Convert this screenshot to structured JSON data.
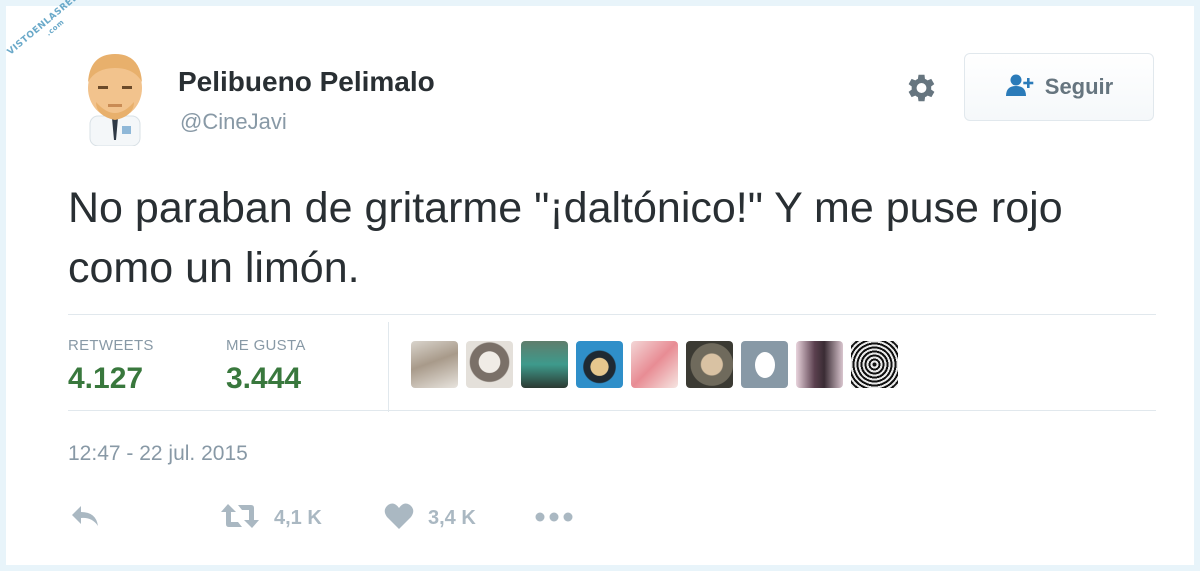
{
  "watermark": {
    "line1": "VISTOENLASREDES",
    "line2": ".com"
  },
  "user": {
    "display_name": "Pelibueno Pelimalo",
    "handle": "@CineJavi"
  },
  "follow_button": {
    "label": "Seguir"
  },
  "tweet": {
    "text": "No paraban de gritarme \"¡daltónico!\" Y me puse rojo como un limón."
  },
  "stats": {
    "retweets_label": "RETWEETS",
    "retweets_value": "4.127",
    "likes_label": "ME GUSTA",
    "likes_value": "3.444"
  },
  "timestamp": "12:47 - 22 jul. 2015",
  "actions": {
    "retweet_count": "4,1 K",
    "like_count": "3,4 K"
  },
  "colors": {
    "stat_value": "#39783d",
    "muted": "#8899a6",
    "icon": "#aab8c2",
    "follow_icon": "#2b7bb9"
  }
}
